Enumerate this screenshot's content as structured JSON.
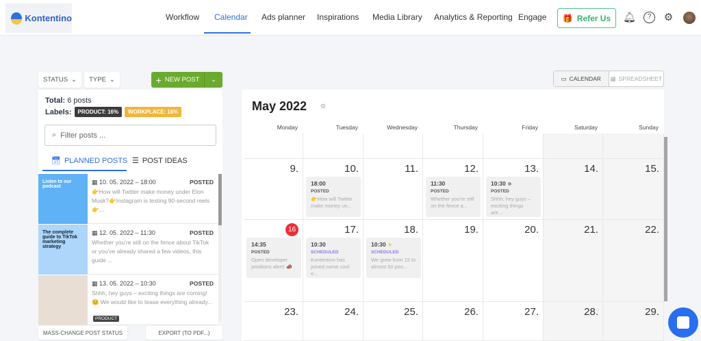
{
  "header": {
    "logo": "Kontentino",
    "nav": [
      "Workflow",
      "Calendar",
      "Ads planner",
      "Inspirations",
      "Media Library",
      "Analytics & Reporting",
      "Engage"
    ],
    "active": "Calendar",
    "refer": "Refer Us"
  },
  "toolbar": {
    "status": "STATUS",
    "type": "TYPE",
    "new_post": "NEW POST",
    "calendar": "CALENDAR",
    "spreadsheet": "SPREADSHEET"
  },
  "sidebar": {
    "total_label": "Total:",
    "total_value": "6 posts",
    "labels_label": "Labels:",
    "tags": [
      {
        "text": "PRODUCT: 16%",
        "color": "#3d3a3a"
      },
      {
        "text": "WORKPLACE: 16%",
        "color": "#f0b63c"
      }
    ],
    "filter_placeholder": "Filter posts ...",
    "tabs": [
      "PLANNED POSTS",
      "POST IDEAS"
    ],
    "posts": [
      {
        "date": "10. 05. 2022 – 18:00",
        "status": "POSTED",
        "text": "👉How will Twitter make money under Elon Musk?👉Instagram is testing 90-second reels👉...",
        "thumb_text": "Listen to our podcast",
        "label": ""
      },
      {
        "date": "12. 05. 2022 – 11:30",
        "status": "POSTED",
        "text": "Whether you're still on the fence about TikTok or you've already shared a few videos, this guide ...",
        "thumb_text": "The complete guide to TikTok marketing strategy",
        "label": ""
      },
      {
        "date": "13. 05. 2022 – 10:30",
        "status": "POSTED",
        "text": "Shhh, hey guys – exciting things are coming! 😊 We would like to tease everything already...",
        "thumb_text": "",
        "label": "PRODUCT"
      }
    ],
    "mass_change": "MASS-CHANGE POST STATUS",
    "export": "EXPORT (TO PDF...)"
  },
  "calendar": {
    "title": "May 2022",
    "weekdays": [
      "Monday",
      "Tuesday",
      "Wednesday",
      "Thursday",
      "Friday",
      "Saturday",
      "Sunday"
    ],
    "weeks": [
      [
        "",
        "",
        "",
        "",
        "",
        "",
        ""
      ],
      [
        "9.",
        "10.",
        "11.",
        "12.",
        "13.",
        "14.",
        "15."
      ],
      [
        "16",
        "17.",
        "18.",
        "19.",
        "20.",
        "21.",
        "22."
      ],
      [
        "23.",
        "24.",
        "25.",
        "26.",
        "27.",
        "28.",
        "29."
      ]
    ],
    "today": "16",
    "events": [
      {
        "week": 1,
        "day": 1,
        "time": "18:00",
        "status": "POSTED",
        "text": "👉How will Twitter make money un...",
        "dot": ""
      },
      {
        "week": 1,
        "day": 3,
        "time": "11:30",
        "status": "POSTED",
        "text": "Whether you're still on the fence a...",
        "dot": ""
      },
      {
        "week": 1,
        "day": 4,
        "time": "10:30",
        "status": "POSTED",
        "text": "Shhh, hey guys – exciting things are...",
        "dot": "#999999"
      },
      {
        "week": 2,
        "day": 0,
        "time": "14:35",
        "status": "POSTED",
        "text": "Open developer positions alert! 📣",
        "dot": ""
      },
      {
        "week": 2,
        "day": 1,
        "time": "10:30",
        "status": "SCHEDULED",
        "text": "Kontentino has joined some cool e...",
        "dot": ""
      },
      {
        "week": 2,
        "day": 2,
        "time": "10:30",
        "status": "SCHEDULED",
        "text": "We grew from 15 to almost 50 peo...",
        "dot": "#f0d58c"
      }
    ]
  }
}
